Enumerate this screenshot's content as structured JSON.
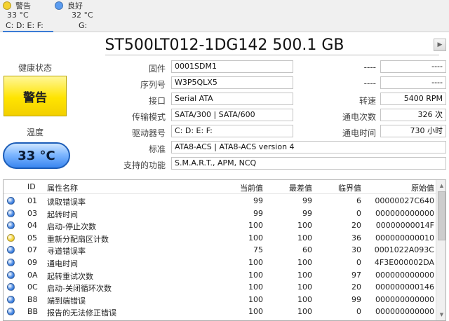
{
  "disk_tabs": [
    {
      "status": "警告",
      "temperature": "33 °C",
      "drives": "C: D: E: F:",
      "color": "#f5d230"
    },
    {
      "status": "良好",
      "temperature": "32 °C",
      "drives": "G:",
      "color": "#5b9cf0"
    }
  ],
  "title": "ST500LT012-1DG142 500.1 GB",
  "next_disk_arrow": "▶",
  "health": {
    "label": "健康状态",
    "value": "警告",
    "color": "#ffe400"
  },
  "temperature": {
    "label": "温度",
    "value": "33 °C"
  },
  "info_left": [
    {
      "label": "固件",
      "value": "0001SDM1"
    },
    {
      "label": "序列号",
      "value": "W3P5QLX5"
    },
    {
      "label": "接口",
      "value": "Serial ATA"
    },
    {
      "label": "传输模式",
      "value": "SATA/300 | SATA/600"
    },
    {
      "label": "驱动器号",
      "value": "C: D: E: F:"
    },
    {
      "label": "标准",
      "value": "ATA8-ACS | ATA8-ACS version 4"
    },
    {
      "label": "支持的功能",
      "value": "S.M.A.R.T., APM, NCQ"
    }
  ],
  "info_right": [
    {
      "label": "----",
      "value": "----"
    },
    {
      "label": "----",
      "value": "----"
    },
    {
      "label": "转速",
      "value": "5400 RPM"
    },
    {
      "label": "通电次数",
      "value": "326 次"
    },
    {
      "label": "通电时间",
      "value": "730 小时"
    }
  ],
  "smart": {
    "headers": {
      "id": "ID",
      "name": "属性名称",
      "current": "当前值",
      "worst": "最差值",
      "threshold": "临界值",
      "raw": "原始值"
    },
    "rows": [
      {
        "status_color": "#3b7fe0",
        "id": "01",
        "name": "读取错误率",
        "current": "99",
        "worst": "99",
        "threshold": "6",
        "raw": "00000027C640"
      },
      {
        "status_color": "#3b7fe0",
        "id": "03",
        "name": "起转时间",
        "current": "99",
        "worst": "99",
        "threshold": "0",
        "raw": "000000000000"
      },
      {
        "status_color": "#3b7fe0",
        "id": "04",
        "name": "启动-停止次数",
        "current": "100",
        "worst": "100",
        "threshold": "20",
        "raw": "00000000014F"
      },
      {
        "status_color": "#f5d230",
        "id": "05",
        "name": "重新分配扇区计数",
        "current": "100",
        "worst": "100",
        "threshold": "36",
        "raw": "000000000010"
      },
      {
        "status_color": "#3b7fe0",
        "id": "07",
        "name": "寻道错误率",
        "current": "75",
        "worst": "60",
        "threshold": "30",
        "raw": "0001022A093C"
      },
      {
        "status_color": "#3b7fe0",
        "id": "09",
        "name": "通电时间",
        "current": "100",
        "worst": "100",
        "threshold": "0",
        "raw": "4F3E000002DA"
      },
      {
        "status_color": "#3b7fe0",
        "id": "0A",
        "name": "起转重试次数",
        "current": "100",
        "worst": "100",
        "threshold": "97",
        "raw": "000000000000"
      },
      {
        "status_color": "#3b7fe0",
        "id": "0C",
        "name": "启动-关闭循环次数",
        "current": "100",
        "worst": "100",
        "threshold": "20",
        "raw": "000000000146"
      },
      {
        "status_color": "#3b7fe0",
        "id": "B8",
        "name": "端到端错误",
        "current": "100",
        "worst": "100",
        "threshold": "99",
        "raw": "000000000000"
      },
      {
        "status_color": "#3b7fe0",
        "id": "BB",
        "name": "报告的无法修正错误",
        "current": "100",
        "worst": "100",
        "threshold": "0",
        "raw": "000000000000"
      }
    ]
  }
}
